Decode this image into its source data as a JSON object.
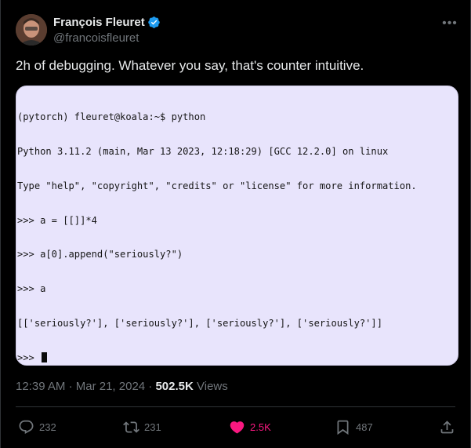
{
  "author": {
    "name": "François Fleuret",
    "handle": "@francoisfleuret",
    "verified": true
  },
  "tweet": {
    "text": "2h of debugging. Whatever you say, that's counter intuitive."
  },
  "terminal": {
    "background": "#e8e4fc",
    "lines": [
      "(pytorch) fleuret@koala:~$ python",
      "Python 3.11.2 (main, Mar 13 2023, 12:18:29) [GCC 12.2.0] on linux",
      "Type \"help\", \"copyright\", \"credits\" or \"license\" for more information.",
      ">>> a = [[]]*4",
      ">>> a[0].append(\"seriously?\")",
      ">>> a",
      "[['seriously?'], ['seriously?'], ['seriously?'], ['seriously?']]",
      ">>> "
    ]
  },
  "meta": {
    "time": "12:39 AM",
    "separator": "·",
    "date": "Mar 21, 2024",
    "views_count": "502.5K",
    "views_label": "Views"
  },
  "actions": {
    "replies": "232",
    "reposts": "231",
    "likes": "2.5K",
    "bookmarks": "487"
  },
  "colors": {
    "background": "#000000",
    "text": "#e7e9ea",
    "muted": "#71767b",
    "like": "#f91880",
    "verified": "#1d9bf0"
  },
  "icons": [
    "verified-badge-icon",
    "more-icon",
    "reply-icon",
    "repost-icon",
    "like-icon",
    "bookmark-icon",
    "share-icon"
  ]
}
